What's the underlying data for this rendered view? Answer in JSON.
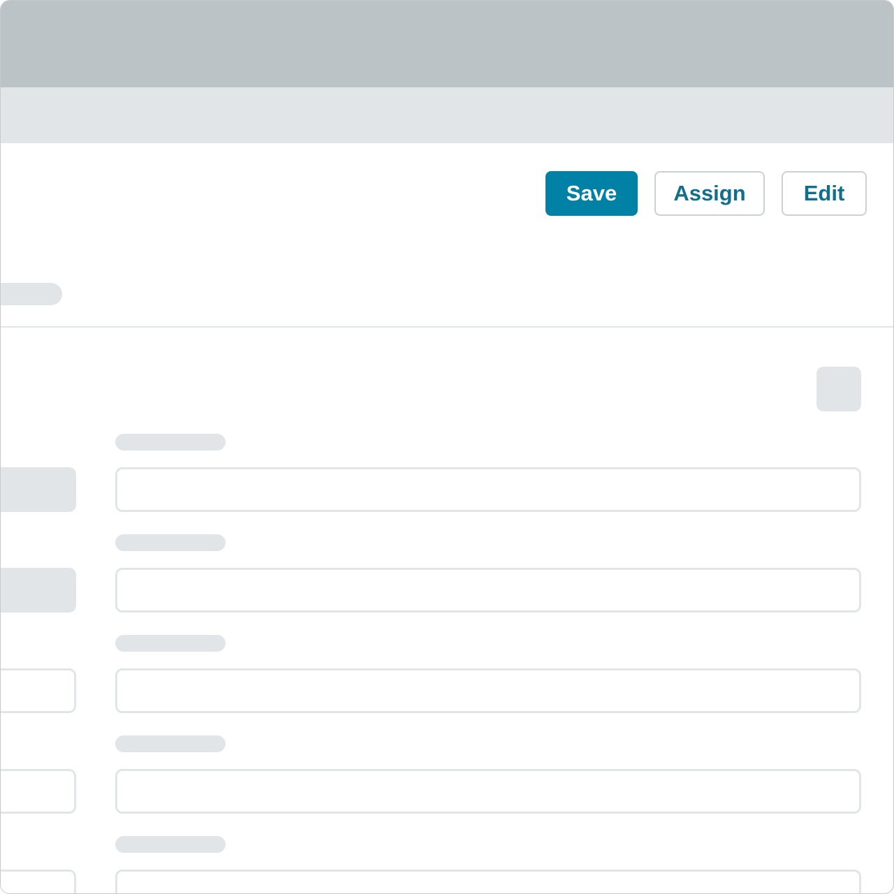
{
  "toolbar": {
    "save_label": "Save",
    "assign_label": "Assign",
    "edit_label": "Edit"
  },
  "colors": {
    "titlebar": "#bcc3c6",
    "subbar": "#e1e5e8",
    "primary": "#0081a5",
    "primary_text": "#ffffff",
    "outline_text": "#116e8c",
    "placeholder": "#e1e5e8"
  },
  "form": {
    "fields": [
      {
        "label": "",
        "value": ""
      },
      {
        "label": "",
        "value": ""
      },
      {
        "label": "",
        "value": ""
      },
      {
        "label": "",
        "value": ""
      },
      {
        "label": "",
        "value": ""
      }
    ]
  }
}
